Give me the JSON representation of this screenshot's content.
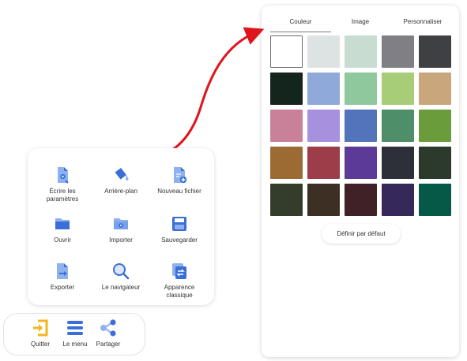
{
  "picker": {
    "tabs": [
      "Couleur",
      "Image",
      "Personnaliser"
    ],
    "active_tab": "Couleur",
    "default_button": "Définir par défaut",
    "swatches": [
      [
        "#ffffff",
        "#dde3e3",
        "#c8dcd2",
        "#7f7f85",
        "#3f4043"
      ],
      [
        "#13251d",
        "#8fa9d8",
        "#8fc89d",
        "#a8cd78",
        "#c9a67b"
      ],
      [
        "#c98199",
        "#a691df",
        "#5174ba",
        "#4e8e69",
        "#6b9c3c"
      ],
      [
        "#9c6b34",
        "#9d3d4a",
        "#5c3a98",
        "#2e3039",
        "#2b3a2b"
      ],
      [
        "#343c2b",
        "#3c3024",
        "#412128",
        "#362858",
        "#065847"
      ]
    ]
  },
  "menu": {
    "items": [
      {
        "label": "Écrire les\nparamètres",
        "icon": "settings-file-icon"
      },
      {
        "label": "Arrière-plan",
        "icon": "paint-bucket-icon"
      },
      {
        "label": "Nouveau fichier",
        "icon": "new-file-icon"
      },
      {
        "label": "Ouvrir",
        "icon": "folder-icon"
      },
      {
        "label": "Importer",
        "icon": "import-folder-icon"
      },
      {
        "label": "Sauvegarder",
        "icon": "save-icon"
      },
      {
        "label": "Exporter",
        "icon": "export-icon"
      },
      {
        "label": "Le navigateur",
        "icon": "magnifier-icon"
      },
      {
        "label": "Apparence\nclassique",
        "icon": "classic-appearance-icon"
      }
    ]
  },
  "bottombar": {
    "items": [
      {
        "label": "Quitter",
        "icon": "exit-icon"
      },
      {
        "label": "Le menu",
        "icon": "menu-icon"
      },
      {
        "label": "Partager",
        "icon": "share-icon"
      }
    ]
  },
  "colors": {
    "accent_blue": "#3a6fd8",
    "light_blue": "#8fb1f0",
    "arrow_red": "#e0141b",
    "exit_yellow": "#f2b71e"
  }
}
